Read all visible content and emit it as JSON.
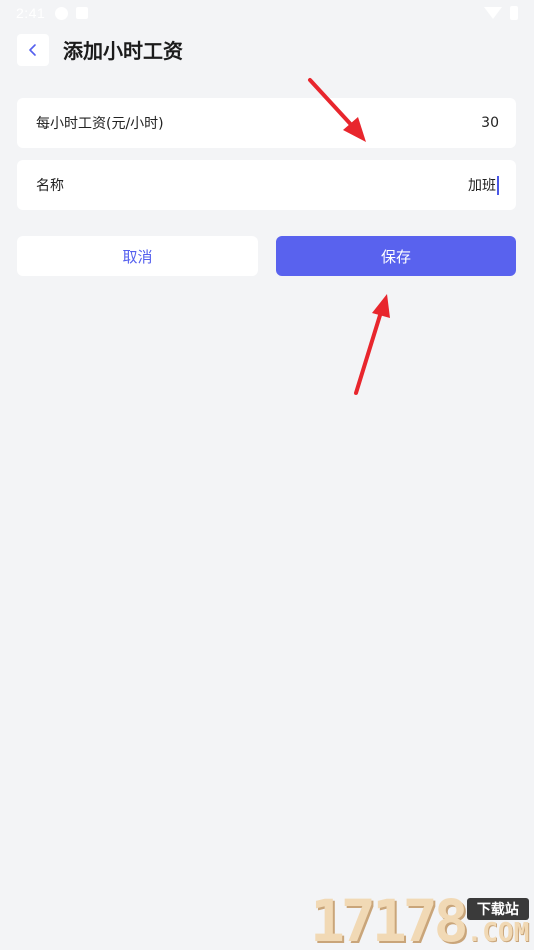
{
  "status_bar": {
    "time": "2:41",
    "icons": [
      "sync-icon",
      "notification-icon",
      "wifi-icon",
      "battery-icon"
    ]
  },
  "header": {
    "title": "添加小时工资",
    "back_icon": "chevron-left-icon"
  },
  "form": {
    "hourly_wage": {
      "label": "每小时工资(元/小时)",
      "value": "30"
    },
    "name": {
      "label": "名称",
      "value": "加班"
    }
  },
  "actions": {
    "cancel_label": "取消",
    "save_label": "保存"
  },
  "watermark": {
    "digits": "17178",
    "tag": "下载站",
    "suffix": ".COM"
  },
  "colors": {
    "accent": "#5962ee",
    "background": "#f3f4f6",
    "arrow": "#e8262d"
  }
}
